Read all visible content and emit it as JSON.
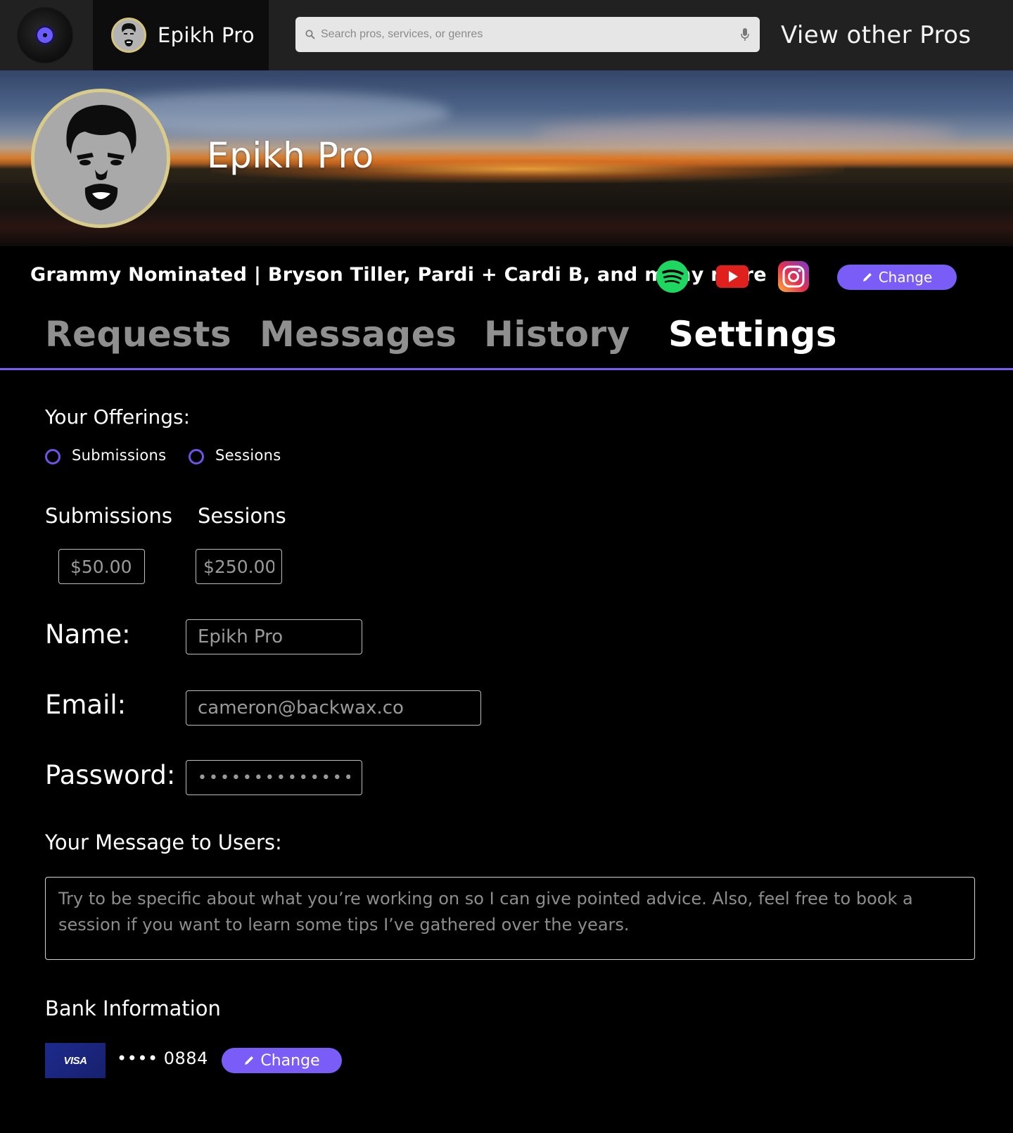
{
  "topbar": {
    "user_name": "Epikh Pro",
    "search_placeholder": "Search pros, services, or genres",
    "view_other_pros": "View other Pros"
  },
  "profile": {
    "name": "Epikh Pro",
    "bio": "Grammy Nominated | Bryson Tiller, Pardi + Cardi B, and many more",
    "social_icons": [
      "spotify-icon",
      "youtube-icon",
      "instagram-icon"
    ],
    "change_label": "Change"
  },
  "tabs": [
    {
      "label": "Requests",
      "active": false
    },
    {
      "label": "Messages",
      "active": false
    },
    {
      "label": "History",
      "active": false
    },
    {
      "label": "Settings",
      "active": true
    }
  ],
  "settings": {
    "offerings_title": "Your Offerings:",
    "offerings": [
      "Submissions",
      "Sessions"
    ],
    "price_headers": [
      "Submissions",
      "Sessions"
    ],
    "submission_price": "$50.00",
    "session_price": "$250.00",
    "name_label": "Name:",
    "name_value": "Epikh Pro",
    "email_label": "Email:",
    "email_value": "cameron@backwax.co",
    "password_label": "Password:",
    "password_value": "••••••••••••••",
    "message_title": "Your Message to Users:",
    "message_value": "Try to be specific about what you’re working on so I can give pointed advice. Also, feel free to book a session if you want to learn some tips I’ve gathered over the years.",
    "bank_title": "Bank Information",
    "card_brand": "VISA",
    "card_number": "•••• 0884",
    "bank_change_label": "Change"
  },
  "colors": {
    "accent": "#7a5cf6",
    "topbar": "#212121",
    "background": "#000000",
    "avatar_ring": "#d9cc8a",
    "spotify": "#1ed760",
    "youtube": "#e0201c"
  }
}
